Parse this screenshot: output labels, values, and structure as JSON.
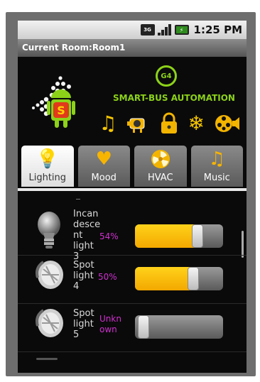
{
  "status_bar": {
    "network_label": "3G",
    "time": "1:25 PM"
  },
  "title_bar": {
    "title": "Current Room:Room1"
  },
  "header": {
    "badge": "G4",
    "brand_text": "SMART-BUS AUTOMATION",
    "logo_letter": "S",
    "icons": [
      "music-icon",
      "projector-icon",
      "lock-icon",
      "snowflake-icon",
      "film-speaker-icon"
    ],
    "accent_color": "#8cd219"
  },
  "tabs": [
    {
      "label": "Lighting",
      "icon": "lightbulb-icon",
      "active": true
    },
    {
      "label": "Mood",
      "icon": "heart-icon",
      "active": false
    },
    {
      "label": "HVAC",
      "icon": "fan-icon",
      "active": false
    },
    {
      "label": "Music",
      "icon": "music-icon",
      "active": false
    }
  ],
  "lights": [
    {
      "name_lines": [
        "Incan",
        "desce",
        "nt",
        "light",
        "3"
      ],
      "value_text": "54%",
      "level": 0.54,
      "icon": "bulb-icon"
    },
    {
      "name_lines": [
        "Spot",
        "light",
        "4"
      ],
      "value_text": "50%",
      "level": 0.5,
      "icon": "spotlight-icon"
    },
    {
      "name_lines": [
        "Spot",
        "light",
        "5"
      ],
      "value_text": "Unkn own",
      "level": 0.0,
      "icon": "spotlight-icon"
    }
  ],
  "colors": {
    "slider_fill": "#f3b400",
    "value_text": "#d030d0"
  }
}
